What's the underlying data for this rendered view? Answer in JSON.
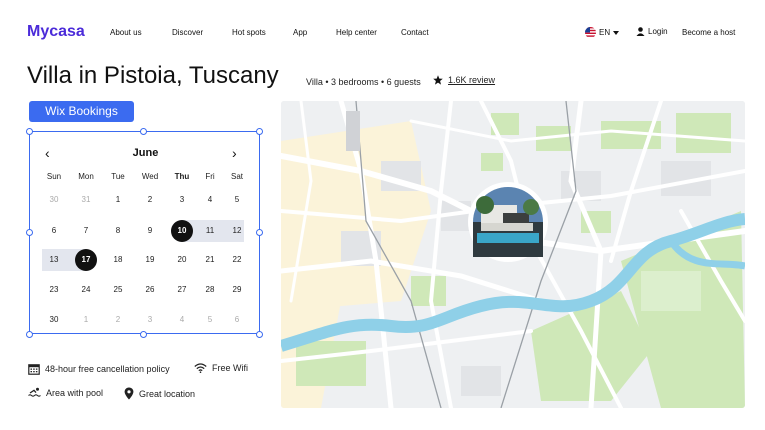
{
  "header": {
    "logo": "Mycasa",
    "nav": [
      "About us",
      "Discover",
      "Hot spots",
      "App",
      "Help center",
      "Contact"
    ],
    "language": "EN",
    "login": "Login",
    "host": "Become a host"
  },
  "listing": {
    "title": "Villa in Pistoia, Tuscany",
    "meta": "Villa • 3 bedrooms • 6 guests",
    "reviews": "1.6K review"
  },
  "widget": {
    "badge": "Wix Bookings"
  },
  "calendar": {
    "month": "June",
    "weekdays": [
      "Sun",
      "Mon",
      "Tue",
      "Wed",
      "Thu",
      "Fri",
      "Sat"
    ],
    "weeks": [
      [
        "30",
        "31",
        "1",
        "2",
        "3",
        "4",
        "5"
      ],
      [
        "6",
        "7",
        "8",
        "9",
        "10",
        "11",
        "12"
      ],
      [
        "13",
        "17",
        "18",
        "19",
        "20",
        "21",
        "22"
      ],
      [
        "23",
        "24",
        "25",
        "26",
        "27",
        "28",
        "29"
      ],
      [
        "30",
        "1",
        "2",
        "3",
        "4",
        "5",
        "6"
      ]
    ]
  },
  "amenities": {
    "cancellation": "48-hour free cancellation policy",
    "wifi": "Free Wifi",
    "pool": "Area with pool",
    "location": "Great location"
  },
  "colors": {
    "brand": "#4b2bd9",
    "selection": "#3b6bf0",
    "river": "#8fd0e8",
    "park": "#cfe8b8"
  }
}
